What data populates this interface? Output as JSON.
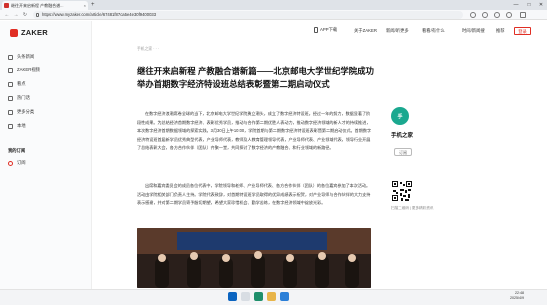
{
  "browser": {
    "tab_title": "继往开来启新程 产教融合谱...",
    "tab_close": "×",
    "new_tab": "+",
    "url": "https://www.myzaker.com/article/67481f87ca5e4e30f9400033"
  },
  "site": {
    "logo_text": "ZAKER",
    "download_app": "APP下载",
    "nav": [
      "关于ZAKER",
      "新闻/听更多",
      "看看/有什么",
      "时间/新闻搜",
      "推荐"
    ],
    "login": "登录"
  },
  "sidebar": {
    "items": [
      {
        "label": "头条新闻",
        "icon": "headline-icon"
      },
      {
        "label": "ZAKER视频",
        "icon": "video-icon"
      },
      {
        "label": "看点",
        "icon": "eye-icon"
      },
      {
        "label": "热门话",
        "icon": "fire-icon"
      },
      {
        "label": "更多分类",
        "icon": "grid-icon"
      },
      {
        "label": "本地",
        "icon": "location-icon"
      }
    ],
    "section_title": "我的订阅",
    "subs": [
      {
        "label": "订阅",
        "icon": "plus-icon"
      }
    ]
  },
  "article": {
    "breadcrumb": "手机之家 · · ·",
    "title": "继往开来启新程 产教融合谱新篇——北京邮电大学世纪学院成功举办首期数字经济特设班总结表彰暨第二期启动仪式",
    "paragraphs": [
      "在数字经济浪潮席卷全球的当下，北京邮电大学世纪学院勇立潮头，成立了数字经济特设班。经过一年的努力，数据显著了阶段性成果。为总结经济首期数字经济、表彰优秀学员，推动与合作第二期优胜人表动力，推动数字经济领域的新人才的持续推进，本次数字经济首期数据领域的探索实践。3月30日上午10:00，学院首期与第二期数字经济特设班表彰暨第二期启动仪式。首期数字经济特设班首届新学员优秀典型代表，产业导师代表，教师及人教育管理领导代表，产业导师代表、产业领域代表，领导行业开展了总结表彰大会，各方合作伙伴（团队）齐聚一堂，共同探讨了数字经济的产教融合、和行业领域的新路径。",
      "出席和嘉宾委员会的成员各位代表中，学院领导和老师、产业导师代表、各方合作伙伴（团队）的各位嘉宾参加了本次活动。活动由学院相关部门负责人主持。学院代表致辞，对首期特设班学员取得的优异成绩表示祝贺，对产业导师与合作伙伴的大力支持表示感谢，并对第二期学员寄予殷切期望，希望大家珍惜机会、勤学苦练，在数字经济领域中绽放光彩。"
    ]
  },
  "author": {
    "name": "手机之家",
    "logo_text": "手",
    "subscribe": "订阅",
    "qr_caption": "扫描二维码 | 更多精彩资讯"
  },
  "taskbar": {
    "time": "22:48",
    "date": "2025/4/9"
  },
  "colors": {
    "brand_red": "#e02e24",
    "author_teal": "#1aa88f"
  }
}
